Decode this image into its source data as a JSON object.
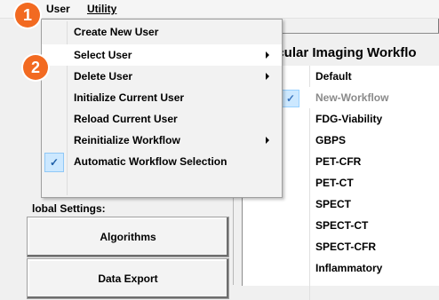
{
  "menubar": {
    "user_label": "User",
    "utility_label": "Utility"
  },
  "user_menu": {
    "items": [
      {
        "label": "Create New User",
        "submenu": false
      },
      {
        "label": "Select User",
        "submenu": true
      },
      {
        "label": "Delete User",
        "submenu": true
      },
      {
        "label": "Initialize Current User",
        "submenu": false
      },
      {
        "label": "Reload Current User",
        "submenu": false
      },
      {
        "label": "Reinitialize Workflow",
        "submenu": true
      },
      {
        "label": "Automatic Workflow Selection",
        "submenu": false,
        "checked": true
      }
    ],
    "highlighted_item": "Select User"
  },
  "left_panel": {
    "global_settings_label": "lobal Settings:",
    "algorithms_button": "Algorithms",
    "data_export_button": "Data Export"
  },
  "workflow_panel": {
    "title": "ecular Imaging Workflo",
    "items": [
      {
        "label": "Default"
      },
      {
        "label": "New-Workflow",
        "checked": true
      },
      {
        "label": "FDG-Viability"
      },
      {
        "label": "GBPS"
      },
      {
        "label": "PET-CFR"
      },
      {
        "label": "PET-CT"
      },
      {
        "label": "SPECT"
      },
      {
        "label": "SPECT-CT"
      },
      {
        "label": "SPECT-CFR"
      },
      {
        "label": "Inflammatory"
      }
    ]
  },
  "badges": {
    "one": "1",
    "two": "2"
  },
  "colors": {
    "badge": "#f26a21",
    "menu_highlight": "#ffffff",
    "check_bg": "#cce8ff"
  }
}
